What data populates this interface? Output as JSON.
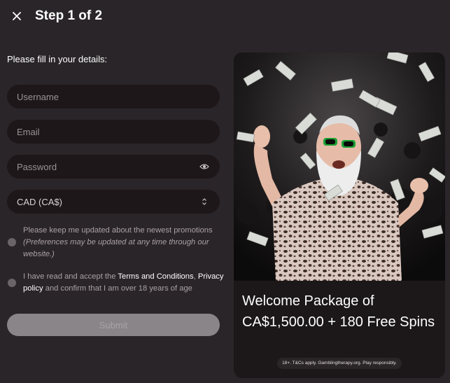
{
  "header": {
    "step_title": "Step 1 of 2"
  },
  "form": {
    "intro": "Please fill in your details:",
    "username_placeholder": "Username",
    "email_placeholder": "Email",
    "password_placeholder": "Password",
    "currency_selected": "CAD (CA$)",
    "promo_consent": "Please keep me updated about the newest promotions",
    "promo_consent_note": "(Preferences may be updated at any time through our website.)",
    "terms_prefix": "I have read and accept the ",
    "terms_link": "Terms and Conditions",
    "terms_comma": ",",
    "privacy_link": "Privacy policy",
    "terms_suffix": " and confirm that I am over 18 years of age",
    "submit_label": "Submit"
  },
  "promo": {
    "title": "Welcome Package of CA$1,500.00 + 180 Free Spins",
    "disclaimer": "18+. T&Cs apply. Gamblingtherapy.org. Play responsibly."
  },
  "colors": {
    "background": "#2a2528",
    "field_bg": "#1e1719",
    "submit_bg": "#8a8589",
    "card_bg": "#1c1819"
  },
  "icons": {
    "close": "close-icon",
    "password_toggle": "eye-icon",
    "currency_select": "chevron-up-down-icon"
  }
}
